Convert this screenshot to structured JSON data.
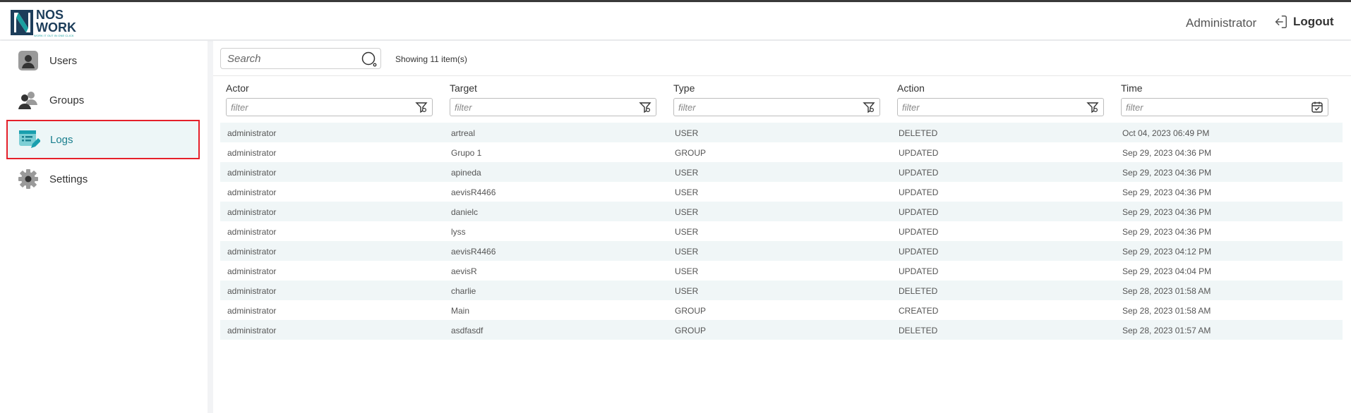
{
  "header": {
    "logo_line1": "NOS",
    "logo_line2": "WORK",
    "logo_tagline": "WORK IT OUT IN ONE CLICK",
    "user_name": "Administrator",
    "logout_label": "Logout"
  },
  "sidebar": {
    "items": [
      {
        "label": "Users",
        "icon": "user-icon",
        "active": false
      },
      {
        "label": "Groups",
        "icon": "group-icon",
        "active": false
      },
      {
        "label": "Logs",
        "icon": "logs-icon",
        "active": true
      },
      {
        "label": "Settings",
        "icon": "gear-icon",
        "active": false
      }
    ]
  },
  "toolbar": {
    "search_placeholder": "Search",
    "showing_text": "Showing 11 item(s)"
  },
  "table": {
    "filter_placeholder": "filter",
    "columns": [
      "Actor",
      "Target",
      "Type",
      "Action",
      "Time"
    ],
    "rows": [
      [
        "administrator",
        "artreal",
        "USER",
        "DELETED",
        "Oct 04, 2023 06:49 PM"
      ],
      [
        "administrator",
        "Grupo 1",
        "GROUP",
        "UPDATED",
        "Sep 29, 2023 04:36 PM"
      ],
      [
        "administrator",
        "apineda",
        "USER",
        "UPDATED",
        "Sep 29, 2023 04:36 PM"
      ],
      [
        "administrator",
        "aevisR4466",
        "USER",
        "UPDATED",
        "Sep 29, 2023 04:36 PM"
      ],
      [
        "administrator",
        "danielc",
        "USER",
        "UPDATED",
        "Sep 29, 2023 04:36 PM"
      ],
      [
        "administrator",
        "lyss",
        "USER",
        "UPDATED",
        "Sep 29, 2023 04:36 PM"
      ],
      [
        "administrator",
        "aevisR4466",
        "USER",
        "UPDATED",
        "Sep 29, 2023 04:12 PM"
      ],
      [
        "administrator",
        "aevisR",
        "USER",
        "UPDATED",
        "Sep 29, 2023 04:04 PM"
      ],
      [
        "administrator",
        "charlie",
        "USER",
        "DELETED",
        "Sep 28, 2023 01:58 AM"
      ],
      [
        "administrator",
        "Main",
        "GROUP",
        "CREATED",
        "Sep 28, 2023 01:58 AM"
      ],
      [
        "administrator",
        "asdfasdf",
        "GROUP",
        "DELETED",
        "Sep 28, 2023 01:57 AM"
      ]
    ]
  },
  "colors": {
    "accent": "#1a7f8e",
    "brand_dark": "#1c3d5a",
    "active_border": "#e5202a",
    "row_stripe": "#f0f6f7"
  }
}
